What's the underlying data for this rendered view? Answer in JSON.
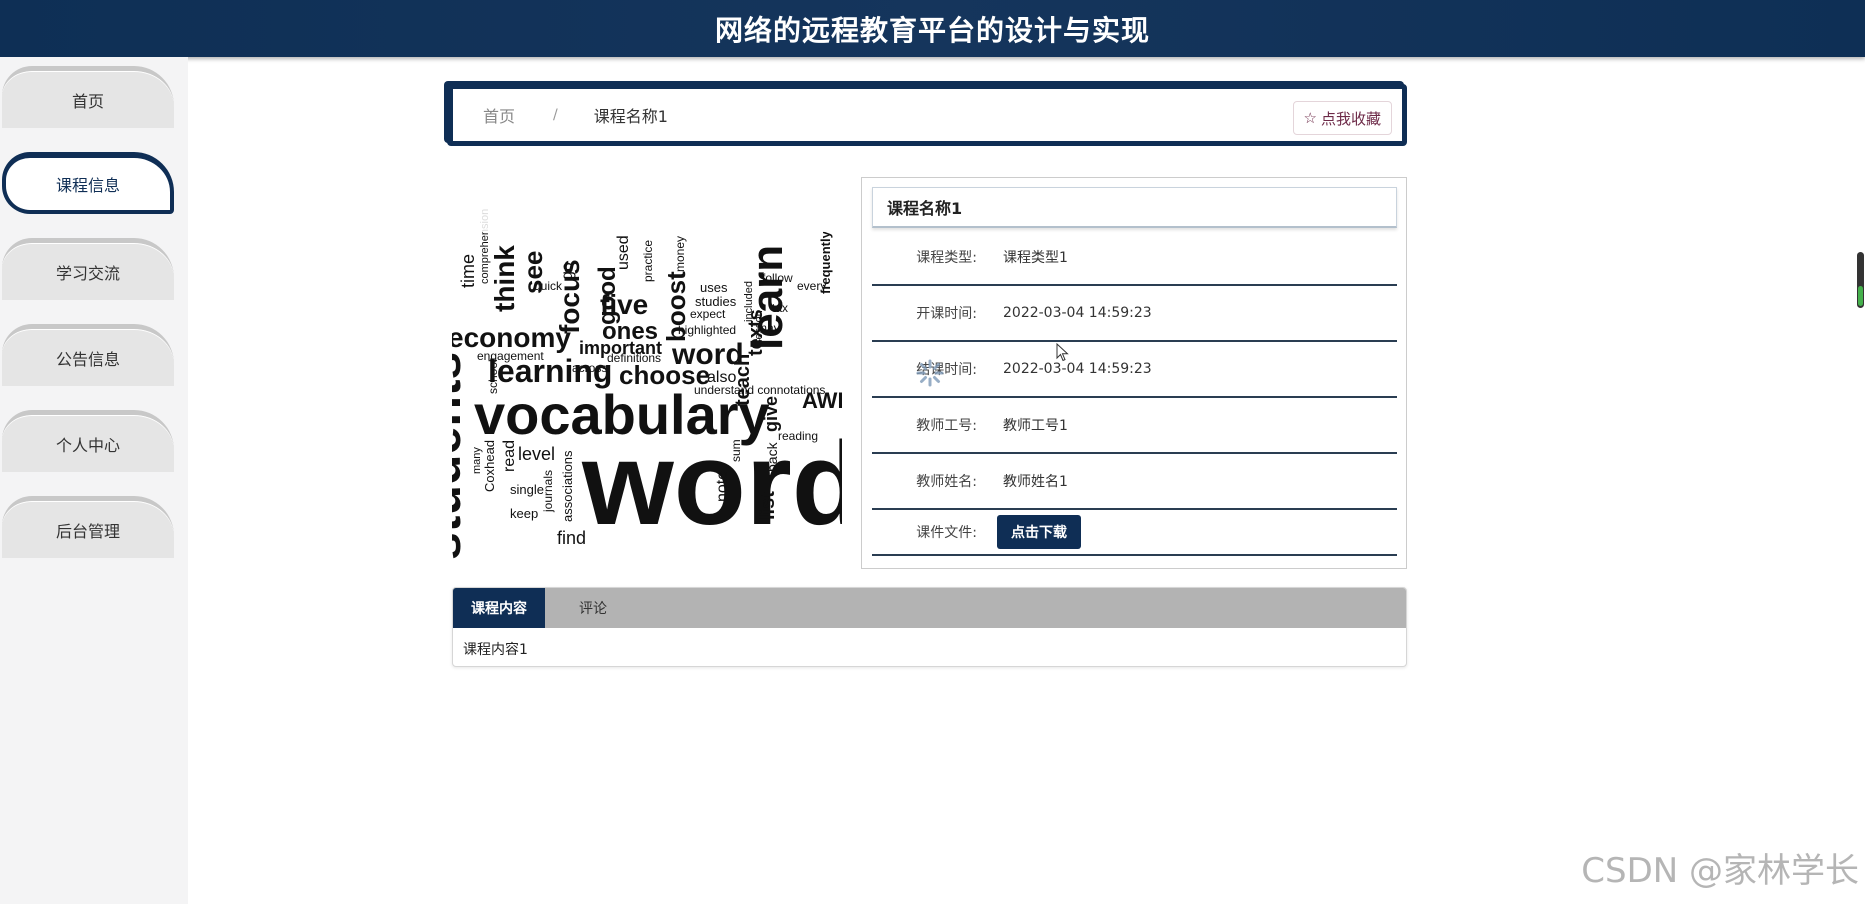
{
  "header": {
    "title": "网络的远程教育平台的设计与实现"
  },
  "sidebar": {
    "items": [
      {
        "label": "首页"
      },
      {
        "label": "课程信息"
      },
      {
        "label": "学习交流"
      },
      {
        "label": "公告信息"
      },
      {
        "label": "个人中心"
      },
      {
        "label": "后台管理"
      }
    ]
  },
  "breadcrumb": {
    "home": "首页",
    "separator": "/",
    "current": "课程名称1"
  },
  "favorite": {
    "label": "点我收藏",
    "icon": "star-outline-icon"
  },
  "course": {
    "name": "课程名称1",
    "rows": [
      {
        "label": "课程类型:",
        "value": "课程类型1"
      },
      {
        "label": "开课时间:",
        "value": "2022-03-04 14:59:23"
      },
      {
        "label": "结课时间:",
        "value": "2022-03-04 14:59:23"
      },
      {
        "label": "教师工号:",
        "value": "教师工号1"
      },
      {
        "label": "教师姓名:",
        "value": "教师姓名1"
      }
    ],
    "file_label": "课件文件:",
    "download_label": "点击下载"
  },
  "tabs": {
    "items": [
      {
        "label": "课程内容"
      },
      {
        "label": "评论"
      }
    ],
    "content": "课程内容1"
  },
  "wordcloud": {
    "words": [
      "word",
      "vocabulary",
      "learning",
      "students",
      "economy",
      "learn",
      "choose",
      "word",
      "important",
      "focus",
      "five",
      "ones",
      "boost",
      "good",
      "think",
      "see",
      "time",
      "teach",
      "texts",
      "give",
      "back",
      "list",
      "find",
      "note",
      "keep",
      "single",
      "journals",
      "associations",
      "level",
      "read",
      "Coxhead",
      "many",
      "school",
      "engagement",
      "comprehension",
      "quick",
      "go",
      "used",
      "practice",
      "money",
      "uses",
      "studies",
      "expect",
      "highlighted",
      "also",
      "across",
      "definitions",
      "understand connotations",
      "reading",
      "sum",
      "included",
      "lesson",
      "tax",
      "may",
      "follow",
      "every",
      "frequently",
      "AWL"
    ]
  },
  "watermark": "CSDN @家林学长"
}
